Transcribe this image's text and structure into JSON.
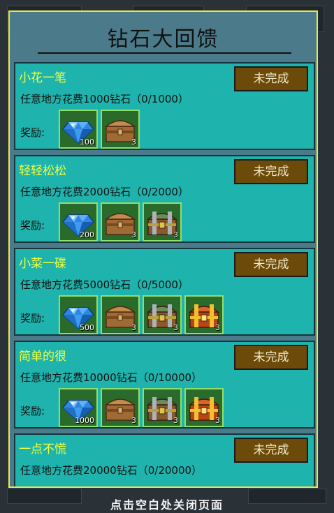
{
  "dialog": {
    "title": "钻石大回馈",
    "reward_label": "奖励:"
  },
  "tasks": [
    {
      "name": "小花一笔",
      "desc": "任意地方花费1000钻石（0/1000）",
      "status": "未完成",
      "rewards": [
        {
          "icon": "diamond-icon",
          "count": "100"
        },
        {
          "icon": "wooden-chest-icon",
          "count": "3"
        }
      ]
    },
    {
      "name": "轻轻松松",
      "desc": "任意地方花费2000钻石（0/2000）",
      "status": "未完成",
      "rewards": [
        {
          "icon": "diamond-icon",
          "count": "200"
        },
        {
          "icon": "wooden-chest-icon",
          "count": "3"
        },
        {
          "icon": "silver-chest-icon",
          "count": "3"
        }
      ]
    },
    {
      "name": "小菜一碟",
      "desc": "任意地方花费5000钻石（0/5000）",
      "status": "未完成",
      "rewards": [
        {
          "icon": "diamond-icon",
          "count": "500"
        },
        {
          "icon": "wooden-chest-icon",
          "count": "3"
        },
        {
          "icon": "silver-chest-icon",
          "count": "3"
        },
        {
          "icon": "gold-chest-icon",
          "count": "3"
        }
      ]
    },
    {
      "name": "简单的很",
      "desc": "任意地方花费10000钻石（0/10000）",
      "status": "未完成",
      "rewards": [
        {
          "icon": "diamond-icon",
          "count": "1000"
        },
        {
          "icon": "wooden-chest-icon",
          "count": "3"
        },
        {
          "icon": "silver-chest-icon",
          "count": "3"
        },
        {
          "icon": "gold-chest-icon",
          "count": "3"
        }
      ]
    },
    {
      "name": "一点不慌",
      "desc": "任意地方花费20000钻石（0/20000）",
      "status": "未完成",
      "rewards": []
    }
  ],
  "footer": {
    "text": "点击空白处关闭页面"
  },
  "colors": {
    "task_bg": "#1fb3ad",
    "title_yellow": "#f4ff3a",
    "button_brown": "#6b4a0a",
    "dialog_border": "#e8e84a"
  }
}
